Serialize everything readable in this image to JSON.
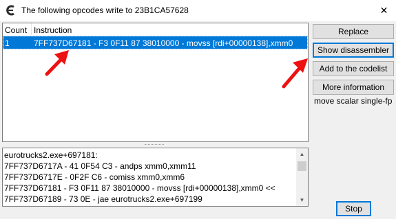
{
  "window": {
    "title": "The following opcodes write to 23B1CA57628",
    "close_glyph": "✕"
  },
  "table": {
    "columns": [
      "Count",
      "Instruction"
    ],
    "rows": [
      {
        "count": "1",
        "instruction": "7FF737D67181 - F3 0F11 87 38010000  - movss [rdi+00000138],xmm0"
      }
    ],
    "selected_row": 0
  },
  "buttons": {
    "replace": "Replace",
    "show_disassembler": "Show disassembler",
    "add_to_codelist": "Add to the codelist",
    "more_information": "More information",
    "stop": "Stop"
  },
  "instruction_description": "move scalar single-fp",
  "disassembly": {
    "lines": [
      "eurotrucks2.exe+697181:",
      "7FF737D6717A - 41 0F54 C3  - andps xmm0,xmm11",
      "7FF737D6717E - 0F2F C6  - comiss xmm0,xmm6",
      "7FF737D67181 - F3 0F11 87 38010000  - movss [rdi+00000138],xmm0 <<",
      "7FF737D67189 - 73 0E - jae eurotrucks2.exe+697199"
    ]
  },
  "icons": {
    "app": "cheat-engine-logo-icon",
    "close": "close-icon",
    "scroll_up": "chevron-up-icon",
    "scroll_down": "chevron-down-icon",
    "annotation": "red-arrow-icon"
  },
  "colors": {
    "selection": "#0078d7",
    "annotation_arrow": "#ee1111",
    "window_bg": "#f0f0f0"
  }
}
